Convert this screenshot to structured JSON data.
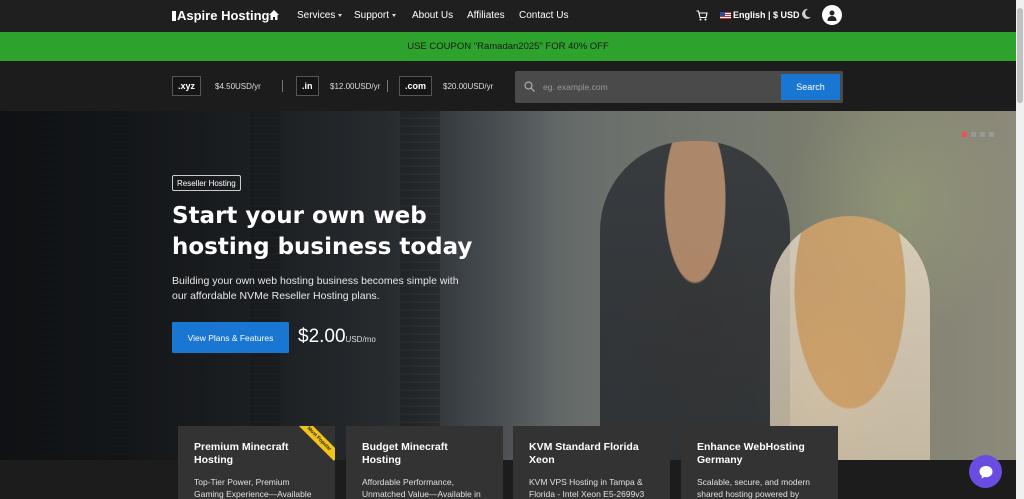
{
  "header": {
    "logo_text": "Aspire Hosting",
    "nav": [
      {
        "label": "Services",
        "dropdown": true
      },
      {
        "label": "Support",
        "dropdown": true
      },
      {
        "label": "About Us",
        "dropdown": false
      },
      {
        "label": "Affiliates",
        "dropdown": false
      },
      {
        "label": "Contact Us",
        "dropdown": false
      }
    ],
    "language_currency": "English | $ USD",
    "icons": [
      "home-icon",
      "cart-icon",
      "flag-us-icon",
      "moon-icon",
      "user-icon"
    ]
  },
  "coupon": {
    "text": "USE COUPON \"Ramadan2025\" FOR 40% OFF",
    "color": "#2da32d"
  },
  "domains": {
    "tlds": [
      {
        "name": ".xyz",
        "price": "$4.50USD/yr"
      },
      {
        "name": ".in",
        "price": "$12.00USD/yr"
      },
      {
        "name": ".com",
        "price": "$20.00USD/yr"
      }
    ],
    "search": {
      "placeholder": "eg. example.com",
      "button_label": "Search"
    }
  },
  "hero": {
    "badge": "Reseller Hosting",
    "headline": "Start your own web hosting business today",
    "subtext": "Building your own web hosting business becomes simple with our affordable NVMe Reseller Hosting plans.",
    "cta_label": "View Plans & Features",
    "price": "$2.00",
    "price_unit": "USD/mo",
    "slides": 4,
    "active_slide": 1
  },
  "cards": [
    {
      "title": "Premium Minecraft Hosting",
      "desc": "Top-Tier Power, Premium Gaming Experience—Available in",
      "ribbon": "Most Popular"
    },
    {
      "title": "Budget Minecraft Hosting",
      "desc": "Affordable Performance, Unmatched Value—Available in",
      "ribbon": ""
    },
    {
      "title": "KVM Standard Florida Xeon",
      "desc": "KVM VPS Hosting in Tampa & Florida - Intel Xeon E5-2699v3",
      "ribbon": ""
    },
    {
      "title": "Enhance WebHosting Germany",
      "desc": "Scalable, secure, and modern shared hosting powered by",
      "ribbon": ""
    }
  ],
  "colors": {
    "accent": "#1976d2",
    "chat": "#6a4ce0",
    "ribbon": "#f2c418"
  }
}
